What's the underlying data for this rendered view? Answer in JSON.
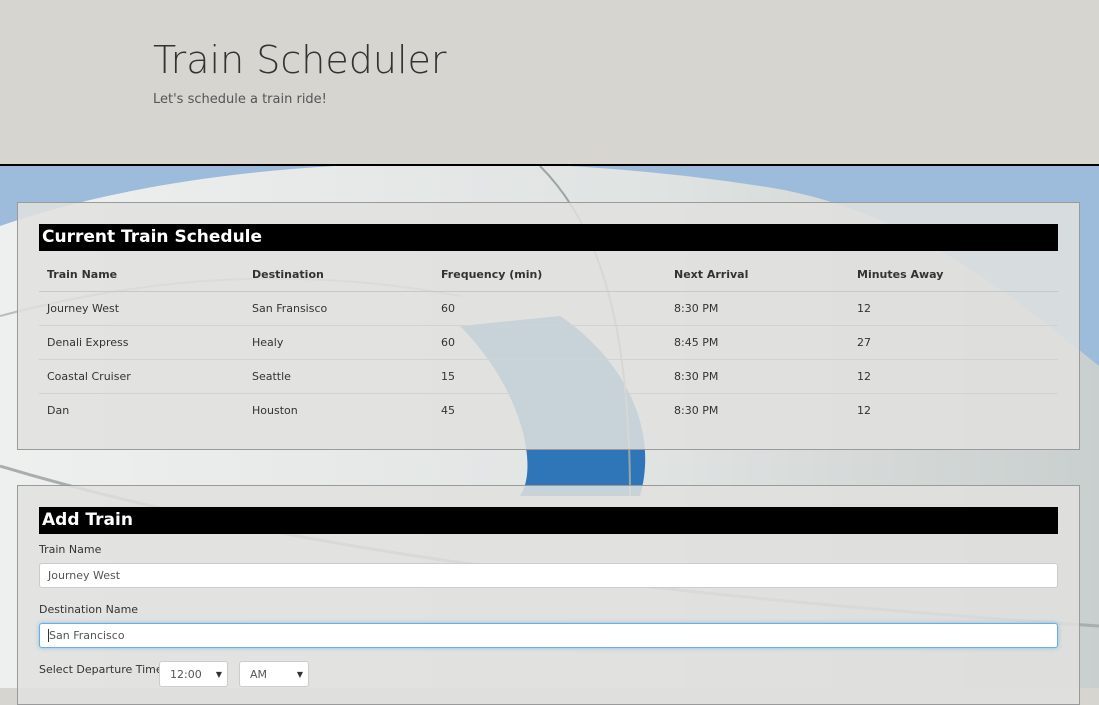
{
  "header": {
    "title": "Train Scheduler",
    "subtitle": "Let's schedule a train ride!"
  },
  "schedule": {
    "heading": "Current Train Schedule",
    "columns": [
      "Train Name",
      "Destination",
      "Frequency (min)",
      "Next Arrival",
      "Minutes Away"
    ],
    "rows": [
      [
        "Journey West",
        "San Fransisco",
        "60",
        "8:30 PM",
        "12"
      ],
      [
        "Denali Express",
        "Healy",
        "60",
        "8:45 PM",
        "27"
      ],
      [
        "Coastal Cruiser",
        "Seattle",
        "15",
        "8:30 PM",
        "12"
      ],
      [
        "Dan",
        "Houston",
        "45",
        "8:30 PM",
        "12"
      ]
    ]
  },
  "add_train": {
    "heading": "Add Train",
    "train_name_label": "Train Name",
    "train_name_value": "Journey West",
    "destination_label": "Destination Name",
    "destination_value": "San Francisco",
    "departure_label": "Select Departure Time",
    "time_value": "12:00",
    "ampm_value": "AM"
  },
  "icons": {
    "dropdown": "chevron-down-icon"
  },
  "colors": {
    "header_bg": "#d6d5d0",
    "panel_head_bg": "#000000",
    "focus_border": "#66afe9"
  }
}
